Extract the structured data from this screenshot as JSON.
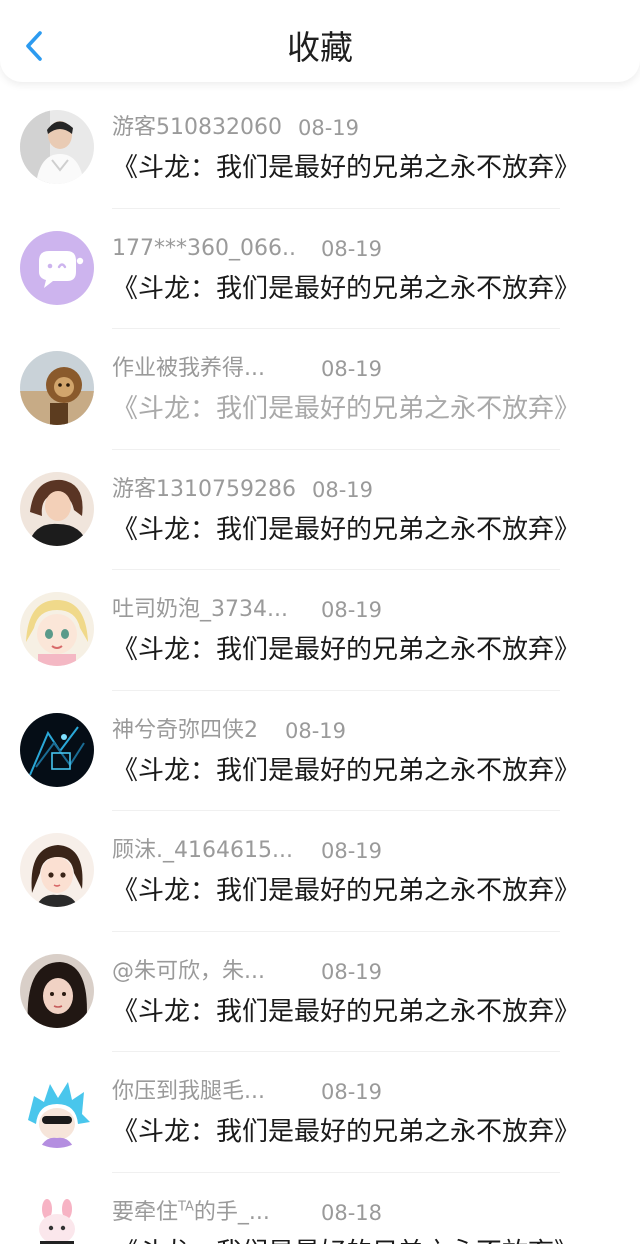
{
  "header": {
    "title": "收藏",
    "back_icon": "chevron-left-icon",
    "accent_color": "#2c9bf0"
  },
  "items": [
    {
      "name": "游客510832060",
      "date": "08-19",
      "message": "《斗龙：我们是最好的兄弟之永不放弃》"
    },
    {
      "name": "177***360_066...",
      "date": "08-19",
      "message": "《斗龙：我们是最好的兄弟之永不放弃》"
    },
    {
      "name": "作业被我养得...",
      "date": "08-19",
      "message": "《斗龙：我们是最好的兄弟之永不放弃》"
    },
    {
      "name": "游客1310759286",
      "date": "08-19",
      "message": "《斗龙：我们是最好的兄弟之永不放弃》"
    },
    {
      "name": "吐司奶泡_3734...",
      "date": "08-19",
      "message": "《斗龙：我们是最好的兄弟之永不放弃》"
    },
    {
      "name": "神兮奇弥四侠2",
      "date": "08-19",
      "message": "《斗龙：我们是最好的兄弟之永不放弃》"
    },
    {
      "name": "顾沫._4164615...",
      "date": "08-19",
      "message": "《斗龙：我们是最好的兄弟之永不放弃》"
    },
    {
      "name": "@朱可欣，朱...",
      "date": "08-19",
      "message": "《斗龙：我们是最好的兄弟之永不放弃》"
    },
    {
      "name": "你压到我腿毛...",
      "date": "08-19",
      "message": "《斗龙：我们是最好的兄弟之永不放弃》"
    },
    {
      "name_prefix": "要牵住",
      "name_sup": "TA",
      "name_suffix": "的手_...",
      "date": "08-18",
      "message": "《斗龙：我们是最好的兄弟之永不放弃》"
    }
  ]
}
